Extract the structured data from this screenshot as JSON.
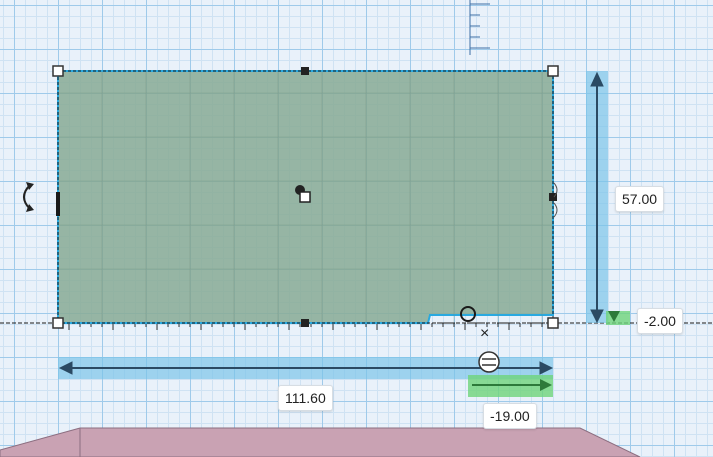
{
  "dimensions": {
    "width": "111.60",
    "height": "57.00",
    "elevation": "-2.00",
    "offset": "-19.00"
  },
  "colors": {
    "shape_fill": "#8aac97",
    "selection_outline": "#29a9e0",
    "dimension_arrow": "#7cc4e8",
    "offset_arrow": "#6ed47a",
    "lower_shape": "#c9a2b3",
    "grid_major": "#9fcaea",
    "grid_minor": "#cfe2f3"
  },
  "icons": {
    "rotate": "rotate-arrow-icon",
    "close": "close-icon",
    "ruler": "ruler-origin-icon",
    "light": "light-cone-icon"
  },
  "close_glyph": "×"
}
